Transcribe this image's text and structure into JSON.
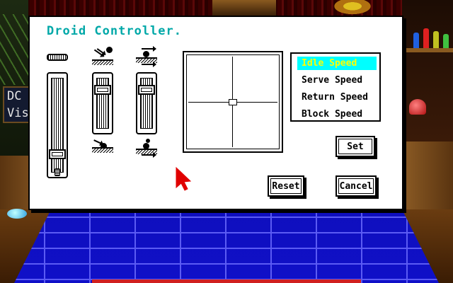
{
  "scene": {
    "sign_lines": [
      "DC",
      "Vis"
    ]
  },
  "dialog": {
    "title": "Droid Controller."
  },
  "sliders": [
    {
      "name": "slider-speed",
      "level": 0.15
    },
    {
      "name": "slider-serve-angle",
      "level": 0.85
    },
    {
      "name": "slider-return",
      "level": 0.85
    }
  ],
  "speed_list": {
    "items": [
      "Idle Speed",
      "Serve Speed",
      "Return Speed",
      "Block Speed"
    ],
    "selected": "Idle Speed"
  },
  "buttons": {
    "set": "Set",
    "reset": "Reset",
    "cancel": "Cancel"
  },
  "colors": {
    "title": "#00a8a8",
    "selected_bg": "#00ffff",
    "selected_text": "#ffff00",
    "pointer": "#e00000"
  }
}
